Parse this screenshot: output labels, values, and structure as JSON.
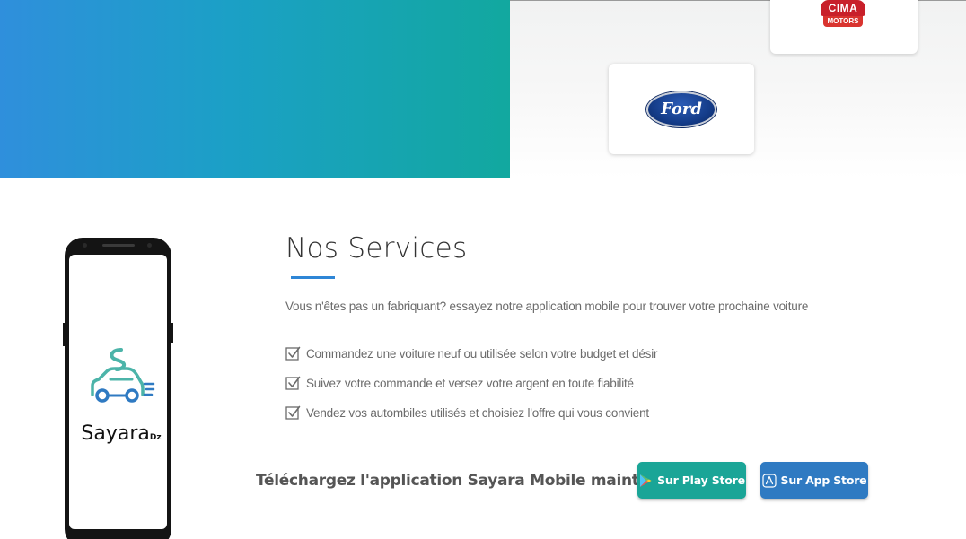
{
  "hero": {
    "brands": [
      {
        "name_top": "CIMA",
        "name_bottom": "MOTORS"
      },
      {
        "name": "Ford"
      }
    ]
  },
  "phone": {
    "app_name": "Sayara",
    "app_suffix": "Dz"
  },
  "services": {
    "title": "Nos Services",
    "intro": "Vous n'êtes pas un fabriquant? essayez notre application mobile pour trouver votre prochaine voiture",
    "features": [
      "Commandez une voiture neuf ou utilisée selon votre budget et désir",
      "Suivez votre commande et versez votre argent en toute fiabilité",
      "Vendez vos autombiles utilisés et choisiez l'offre qui vous convient"
    ]
  },
  "download": {
    "text": "Téléchargez l'application Sayara Mobile maintenant !",
    "play_store_label": "Sur Play Store",
    "app_store_label": "Sur App Store"
  },
  "colors": {
    "accent_blue": "#2e86d6",
    "play_green": "#1aa597",
    "app_blue": "#2f7ac2",
    "hero_gradient_start": "#2f8fdc",
    "hero_gradient_end": "#12a89f"
  },
  "icons": [
    "checkbox-icon",
    "play-store-icon",
    "app-store-icon",
    "car-logo-icon"
  ]
}
